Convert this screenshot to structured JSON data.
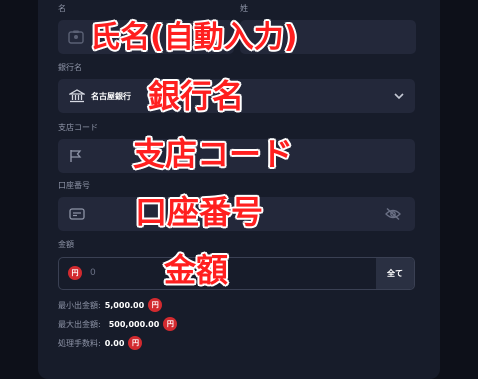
{
  "form": {
    "given_name_label": "名",
    "family_name_label": "姓",
    "bank_label": "銀行名",
    "bank_value": "名古屋銀行",
    "branch_label": "支店コード",
    "account_label": "口座番号",
    "amount_label": "金額",
    "amount_value": "0",
    "all_button": "全て",
    "currency_symbol": "円"
  },
  "limits": {
    "min_label": "最小出金額:",
    "min_value": "5,000.00",
    "max_label": "最大出金額:",
    "max_value": "500,000.00",
    "fee_label": "処理手数料:",
    "fee_value": "0.00"
  },
  "annotations": {
    "name": "氏名(自動入力)",
    "bank": "銀行名",
    "branch": "支店コード",
    "account": "口座番号",
    "amount": "金額"
  },
  "colors": {
    "background": "#0d1019",
    "panel": "#171c2a",
    "field": "#23283a",
    "annotation": "#ff1f1f",
    "yen_badge": "#d22a2f"
  },
  "icons": {
    "name_field": "id-card-icon",
    "bank_field": "bank-icon",
    "bank_dropdown": "chevron-down-icon",
    "branch_field": "flag-icon",
    "account_field": "card-icon",
    "account_visibility": "eye-off-icon",
    "currency": "yen-icon"
  }
}
